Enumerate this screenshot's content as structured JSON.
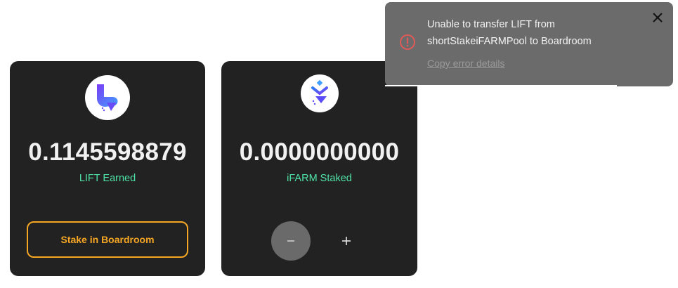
{
  "cards": [
    {
      "token_icon": "lift-logo-icon",
      "amount": "0.1145598879",
      "label": "LIFT Earned",
      "action_label": "Stake in Boardroom"
    },
    {
      "token_icon": "ifarm-logo-icon",
      "amount": "0.0000000000",
      "label": "iFARM Staked",
      "controls": {
        "minus_icon": "minus-icon",
        "plus_icon": "plus-icon"
      }
    }
  ],
  "toast": {
    "message_line1": "Unable to transfer LIFT from",
    "message_line2": "shortStakeiFARMPool to Boardroom",
    "copy_link": "Copy error details",
    "icon": "error-circle-icon",
    "close_icon": "close-icon"
  },
  "colors": {
    "card_bg": "#222222",
    "accent_green": "#4fe3a8",
    "accent_orange": "#f5a623",
    "toast_bg": "#6b6b6b",
    "error_red": "#e05a5a"
  }
}
